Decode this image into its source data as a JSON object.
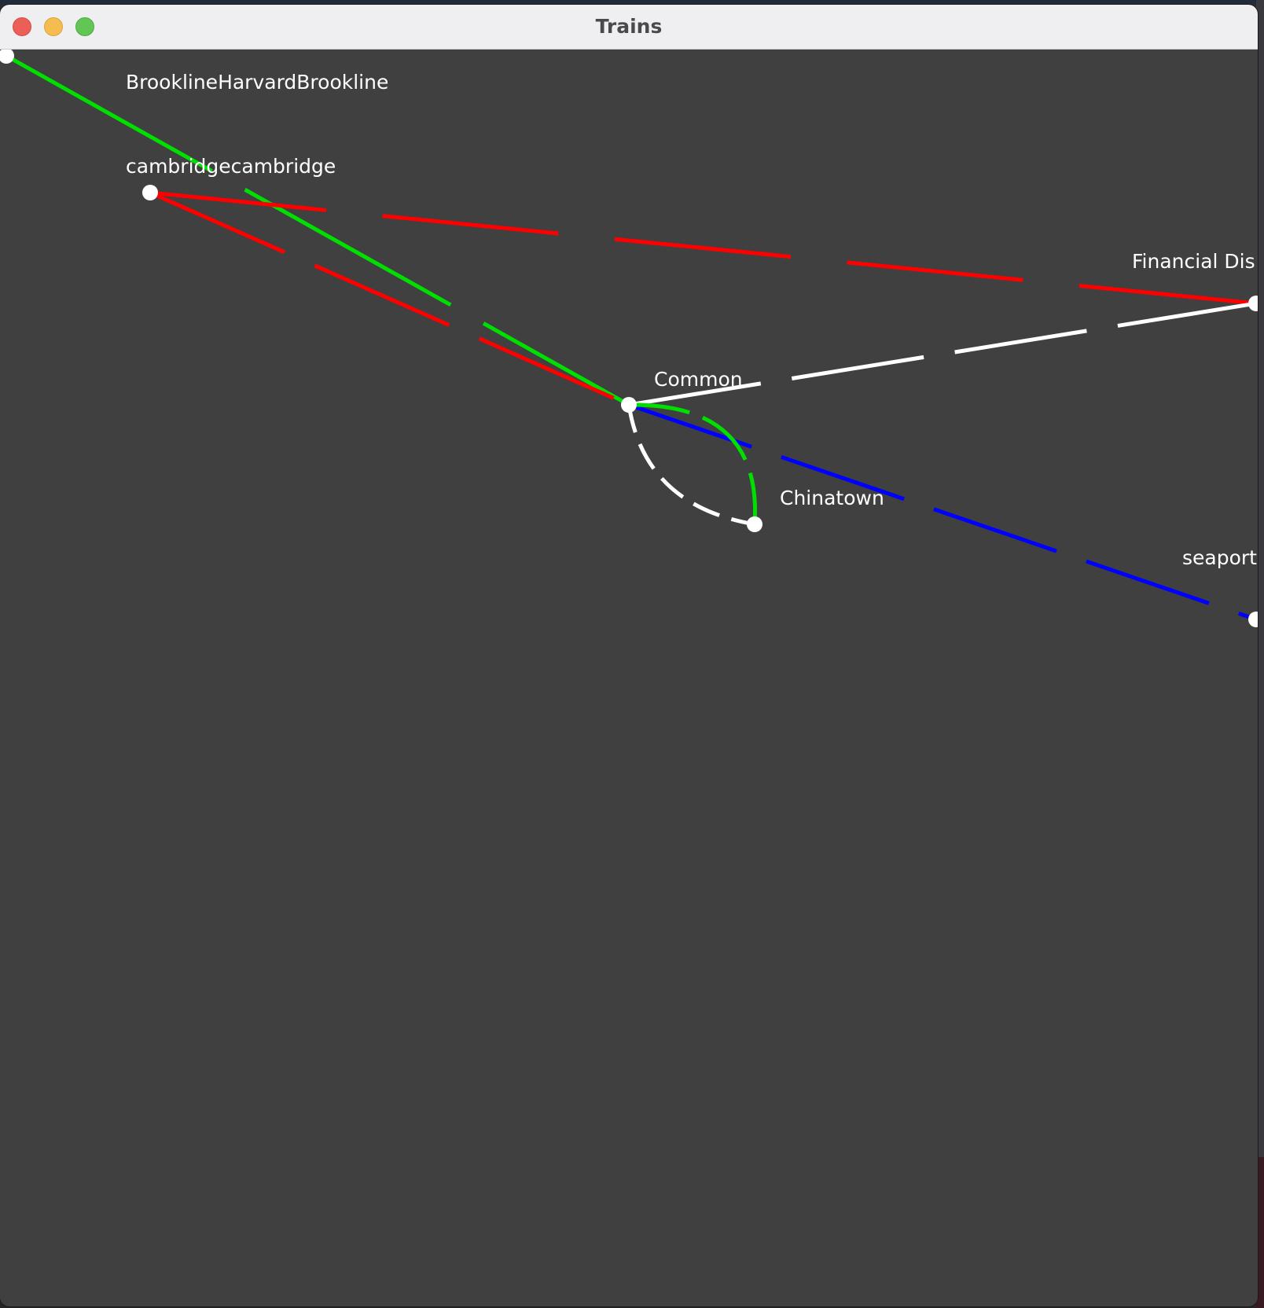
{
  "window": {
    "title": "Trains"
  },
  "map": {
    "stations": [
      {
        "id": "brookline",
        "label": "BrooklineHarvardBrookline"
      },
      {
        "id": "cambridge",
        "label": "cambridgecambridge"
      },
      {
        "id": "common",
        "label": "Common"
      },
      {
        "id": "chinatown",
        "label": "Chinatown"
      },
      {
        "id": "financial",
        "label": "Financial Dis"
      },
      {
        "id": "seaport",
        "label": "seaport"
      }
    ],
    "lines": [
      {
        "color": "#00e000",
        "name": "green",
        "from": "brookline",
        "to": "common"
      },
      {
        "color": "#ff0000",
        "name": "red",
        "from": "cambridge",
        "to": "common"
      },
      {
        "color": "#ff0000",
        "name": "red",
        "from": "cambridge",
        "to": "financial"
      },
      {
        "color": "#ffffff",
        "name": "white",
        "from": "common",
        "to": "financial"
      },
      {
        "color": "#0000ff",
        "name": "blue",
        "from": "common",
        "to": "seaport"
      },
      {
        "color": "#00e000",
        "name": "green",
        "from": "common",
        "to": "chinatown"
      },
      {
        "color": "#ffffff",
        "name": "white",
        "from": "common",
        "to": "chinatown"
      }
    ],
    "colors": {
      "background": "#404040",
      "station_dot": "#ffffff",
      "label_text": "#ffffff"
    }
  }
}
